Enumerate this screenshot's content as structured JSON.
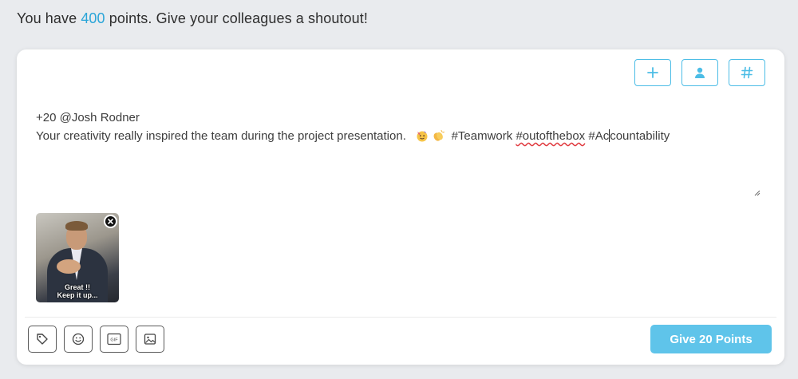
{
  "header": {
    "prefix": "You have ",
    "points": "400",
    "suffix": " points. Give your colleagues a shoutout!"
  },
  "toolbar_top": {
    "icons": [
      "plus-icon",
      "person-icon",
      "hashtag-icon"
    ]
  },
  "composer": {
    "line1": "+20 @Josh Rodner",
    "message": "Your creativity really inspired the team during the project presentation.",
    "emojis": [
      "party-face-emoji",
      "clapping-hands-emoji"
    ],
    "tag1": "#Teamwork",
    "tag2": "#outofthebox",
    "tag3_before_caret": "#Ac",
    "tag3_after_caret": "countability"
  },
  "attachment": {
    "caption_line1": "Great !!",
    "caption_line2": "Keep it up..."
  },
  "toolbar_bottom": {
    "gif_label": "GIF",
    "icons": [
      "tag-icon",
      "emoji-icon",
      "gif-icon",
      "image-icon"
    ]
  },
  "submit": {
    "label": "Give 20 Points"
  },
  "colors": {
    "accent": "#4cbde6",
    "button": "#5fc4ea",
    "points": "#2aa5d8"
  }
}
